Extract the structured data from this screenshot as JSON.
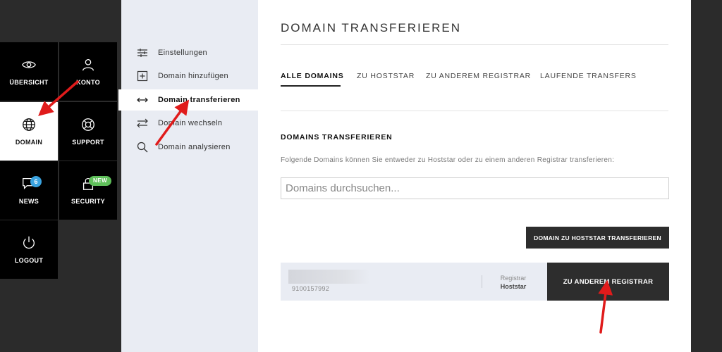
{
  "sidebar": {
    "tiles": [
      {
        "label": "ÜBERSICHT",
        "icon": "eye-icon"
      },
      {
        "label": "KONTO",
        "icon": "user-icon"
      },
      {
        "label": "DOMAIN",
        "icon": "globe-icon"
      },
      {
        "label": "SUPPORT",
        "icon": "lifebuoy-icon"
      },
      {
        "label": "NEWS",
        "icon": "chat-icon",
        "badge": "6"
      },
      {
        "label": "SECURITY",
        "icon": "lock-icon",
        "badge": "NEW"
      },
      {
        "label": "LOGOUT",
        "icon": "power-icon"
      }
    ]
  },
  "subnav": {
    "items": [
      {
        "label": "Einstellungen",
        "icon": "sliders-icon"
      },
      {
        "label": "Domain hinzufügen",
        "icon": "plus-square-icon"
      },
      {
        "label": "Domain transferieren",
        "icon": "double-arrow-icon"
      },
      {
        "label": "Domain wechseln",
        "icon": "swap-arrows-icon"
      },
      {
        "label": "Domain analysieren",
        "icon": "search-icon"
      }
    ],
    "active_index": 2
  },
  "main": {
    "title": "DOMAIN TRANSFERIEREN",
    "tabs": [
      {
        "label": "ALLE DOMAINS"
      },
      {
        "label": "ZU HOSTSTAR"
      },
      {
        "label": "ZU ANDEREM REGISTRAR"
      },
      {
        "label": "LAUFENDE TRANSFERS"
      }
    ],
    "active_tab": 0,
    "section_title": "DOMAINS TRANSFERIEREN",
    "section_desc": "Folgende Domains können Sie entweder zu Hoststar oder zu einem anderen Registrar transferieren:",
    "search_placeholder": "Domains durchsuchen...",
    "transfer_hoststar_label": "DOMAIN ZU HOSTSTAR TRANSFERIEREN",
    "domain_row": {
      "domain_id": "9100157992",
      "registrar_label": "Registrar",
      "registrar_value": "Hoststar",
      "action_label": "ZU ANDEREM REGISTRAR"
    }
  },
  "colors": {
    "dark_bg": "#2b2b2b",
    "tile_bg": "#000000",
    "subnav_bg": "#e9ecf3",
    "button_bg": "#2d2d2d",
    "annotation_arrow": "#e01b1b",
    "badge_blue": "#3aa3e0",
    "badge_green": "#5fbf5a"
  }
}
